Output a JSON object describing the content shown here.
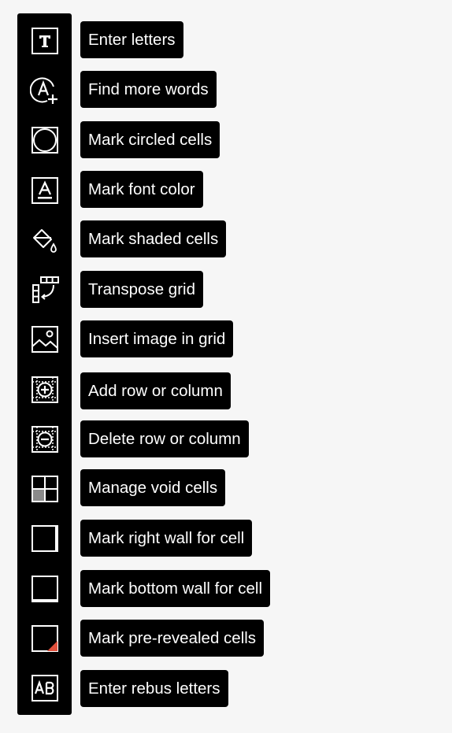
{
  "accent": {
    "red": "#e0503c",
    "grey": "#8a8a8a"
  },
  "tools": [
    {
      "icon": "text-t-icon",
      "label": "Enter letters"
    },
    {
      "icon": "letter-a-plus-icon",
      "label": "Find more words"
    },
    {
      "icon": "circle-icon",
      "label": "Mark circled cells"
    },
    {
      "icon": "font-color-icon",
      "label": "Mark font color"
    },
    {
      "icon": "paint-bucket-icon",
      "label": "Mark shaded cells"
    },
    {
      "icon": "transpose-icon",
      "label": "Transpose grid"
    },
    {
      "icon": "image-icon",
      "label": "Insert image in grid"
    },
    {
      "icon": "grid-add-icon",
      "label": "Add row or column"
    },
    {
      "icon": "grid-remove-icon",
      "label": "Delete row or column"
    },
    {
      "icon": "void-cells-icon",
      "label": "Manage void cells"
    },
    {
      "icon": "right-wall-icon",
      "label": "Mark right wall for cell"
    },
    {
      "icon": "bottom-wall-icon",
      "label": "Mark bottom wall for cell"
    },
    {
      "icon": "pre-revealed-icon",
      "label": "Mark pre-revealed cells"
    },
    {
      "icon": "rebus-ab-icon",
      "label": "Enter rebus letters"
    }
  ]
}
